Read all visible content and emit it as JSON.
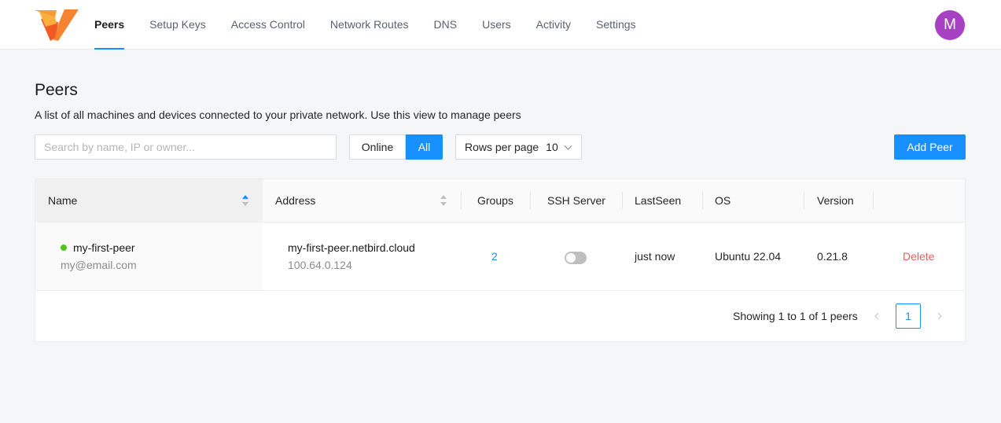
{
  "header": {
    "logo": "netbird-logo",
    "nav": [
      {
        "label": "Peers",
        "active": true
      },
      {
        "label": "Setup Keys",
        "active": false
      },
      {
        "label": "Access Control",
        "active": false
      },
      {
        "label": "Network Routes",
        "active": false
      },
      {
        "label": "DNS",
        "active": false
      },
      {
        "label": "Users",
        "active": false
      },
      {
        "label": "Activity",
        "active": false
      },
      {
        "label": "Settings",
        "active": false
      }
    ],
    "avatar_initial": "M",
    "avatar_color": "#a840c4"
  },
  "page": {
    "title": "Peers",
    "description": "A list of all machines and devices connected to your private network. Use this view to manage peers"
  },
  "toolbar": {
    "search_placeholder": "Search by name, IP or owner...",
    "filter_online": "Online",
    "filter_all": "All",
    "rows_per_page_label": "Rows per page",
    "rows_per_page_value": "10",
    "add_peer_label": "Add Peer"
  },
  "table": {
    "columns": [
      "Name",
      "Address",
      "Groups",
      "SSH Server",
      "LastSeen",
      "OS",
      "Version"
    ],
    "rows": [
      {
        "name": "my-first-peer",
        "owner": "my@email.com",
        "status": "online",
        "address_host": "my-first-peer.netbird.cloud",
        "address_ip": "100.64.0.124",
        "groups": "2",
        "ssh_server": false,
        "last_seen": "just now",
        "os": "Ubuntu 22.04",
        "version": "0.21.8",
        "action": "Delete"
      }
    ]
  },
  "pagination": {
    "summary": "Showing 1 to 1 of 1 peers",
    "current_page": "1"
  },
  "colors": {
    "accent": "#1890ff",
    "online": "#52c41a",
    "danger": "#e0605a",
    "logo_orange": "#f68330"
  }
}
